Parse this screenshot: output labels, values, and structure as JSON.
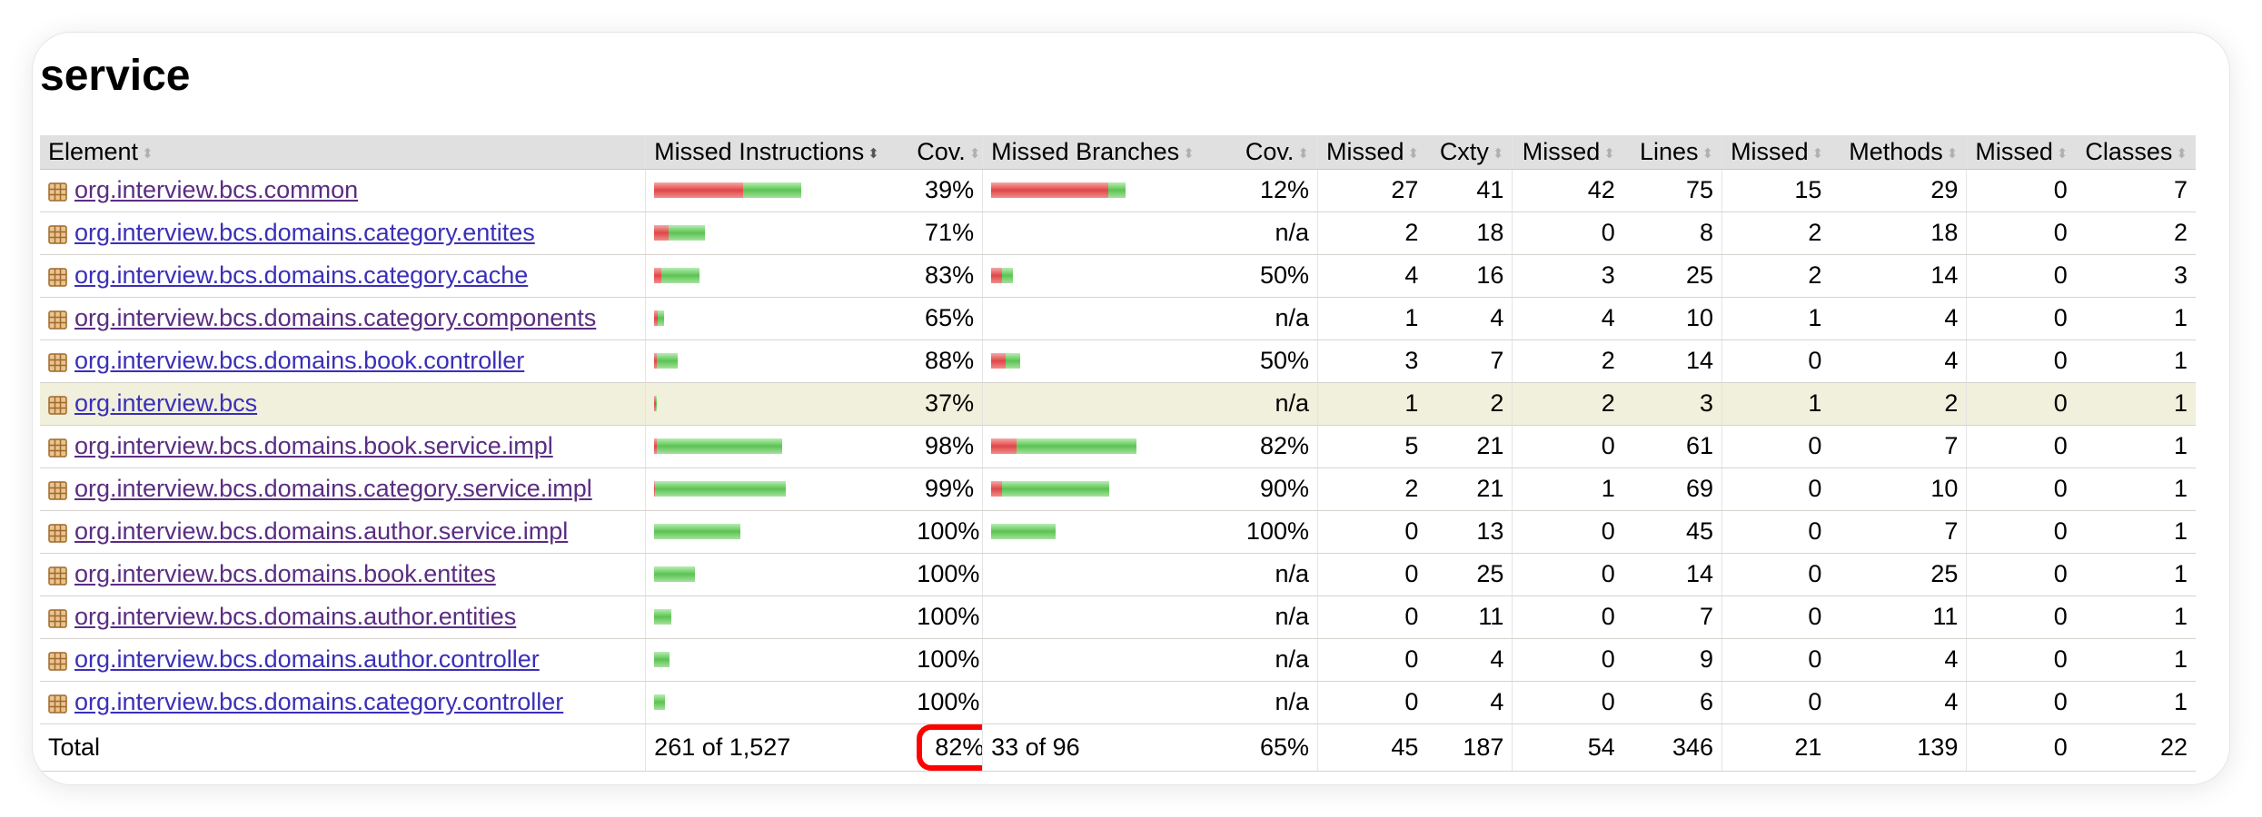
{
  "page": {
    "title": "service"
  },
  "headers": {
    "element": "Element",
    "missed_instructions": "Missed Instructions",
    "cov_instr": "Cov.",
    "missed_branches": "Missed Branches",
    "cov_branch": "Cov.",
    "missed_cxty": "Missed",
    "cxty": "Cxty",
    "missed_lines": "Missed",
    "lines": "Lines",
    "missed_methods": "Missed",
    "methods": "Methods",
    "missed_classes": "Missed",
    "classes": "Classes"
  },
  "sort_icons": {
    "default": "sort-icon",
    "active": "sort-desc-icon"
  },
  "rows": [
    {
      "name": "org.interview.bcs.common",
      "visited": true,
      "instr_bar": {
        "missed": 0.37,
        "covered": 0.24
      },
      "instr_cov": "39%",
      "branch_bar": {
        "missed": 0.55,
        "covered": 0.08
      },
      "branch_cov": "12%",
      "missed_cxty": "27",
      "cxty": "41",
      "missed_lines": "42",
      "lines": "75",
      "missed_methods": "15",
      "methods": "29",
      "missed_classes": "0",
      "classes": "7"
    },
    {
      "name": "org.interview.bcs.domains.category.entites",
      "visited": false,
      "instr_bar": {
        "missed": 0.06,
        "covered": 0.15
      },
      "instr_cov": "71%",
      "branch_bar": null,
      "branch_cov": "n/a",
      "missed_cxty": "2",
      "cxty": "18",
      "missed_lines": "0",
      "lines": "8",
      "missed_methods": "2",
      "methods": "18",
      "missed_classes": "0",
      "classes": "2"
    },
    {
      "name": "org.interview.bcs.domains.category.cache",
      "visited": false,
      "instr_bar": {
        "missed": 0.03,
        "covered": 0.16
      },
      "instr_cov": "83%",
      "branch_bar": {
        "missed": 0.05,
        "covered": 0.05
      },
      "branch_cov": "50%",
      "missed_cxty": "4",
      "cxty": "16",
      "missed_lines": "3",
      "lines": "25",
      "missed_methods": "2",
      "methods": "14",
      "missed_classes": "0",
      "classes": "3"
    },
    {
      "name": "org.interview.bcs.domains.category.components",
      "visited": true,
      "instr_bar": {
        "missed": 0.015,
        "covered": 0.027
      },
      "instr_cov": "65%",
      "branch_bar": null,
      "branch_cov": "n/a",
      "missed_cxty": "1",
      "cxty": "4",
      "missed_lines": "4",
      "lines": "10",
      "missed_methods": "1",
      "methods": "4",
      "missed_classes": "0",
      "classes": "1"
    },
    {
      "name": "org.interview.bcs.domains.book.controller",
      "visited": false,
      "instr_bar": {
        "missed": 0.012,
        "covered": 0.085
      },
      "instr_cov": "88%",
      "branch_bar": {
        "missed": 0.07,
        "covered": 0.07
      },
      "branch_cov": "50%",
      "missed_cxty": "3",
      "cxty": "7",
      "missed_lines": "2",
      "lines": "14",
      "missed_methods": "0",
      "methods": "4",
      "missed_classes": "0",
      "classes": "1"
    },
    {
      "name": "org.interview.bcs",
      "visited": false,
      "highlight": true,
      "instr_bar": {
        "missed": 0.006,
        "covered": 0.004
      },
      "instr_cov": "37%",
      "branch_bar": null,
      "branch_cov": "n/a",
      "missed_cxty": "1",
      "cxty": "2",
      "missed_lines": "2",
      "lines": "3",
      "missed_methods": "1",
      "methods": "2",
      "missed_classes": "0",
      "classes": "1"
    },
    {
      "name": "org.interview.bcs.domains.book.service.impl",
      "visited": true,
      "instr_bar": {
        "missed": 0.01,
        "covered": 0.52
      },
      "instr_cov": "98%",
      "branch_bar": {
        "missed": 0.12,
        "covered": 0.56
      },
      "branch_cov": "82%",
      "missed_cxty": "5",
      "cxty": "21",
      "missed_lines": "0",
      "lines": "61",
      "missed_methods": "0",
      "methods": "7",
      "missed_classes": "0",
      "classes": "1"
    },
    {
      "name": "org.interview.bcs.domains.category.service.impl",
      "visited": true,
      "instr_bar": {
        "missed": 0.005,
        "covered": 0.545
      },
      "instr_cov": "99%",
      "branch_bar": {
        "missed": 0.05,
        "covered": 0.5
      },
      "branch_cov": "90%",
      "missed_cxty": "2",
      "cxty": "21",
      "missed_lines": "1",
      "lines": "69",
      "missed_methods": "0",
      "methods": "10",
      "missed_classes": "0",
      "classes": "1"
    },
    {
      "name": "org.interview.bcs.domains.author.service.impl",
      "visited": true,
      "instr_bar": {
        "missed": 0,
        "covered": 0.36
      },
      "instr_cov": "100%",
      "branch_bar": {
        "missed": 0,
        "covered": 0.3
      },
      "branch_cov": "100%",
      "missed_cxty": "0",
      "cxty": "13",
      "missed_lines": "0",
      "lines": "45",
      "missed_methods": "0",
      "methods": "7",
      "missed_classes": "0",
      "classes": "1"
    },
    {
      "name": "org.interview.bcs.domains.book.entites",
      "visited": true,
      "instr_bar": {
        "missed": 0,
        "covered": 0.17
      },
      "instr_cov": "100%",
      "branch_bar": null,
      "branch_cov": "n/a",
      "missed_cxty": "0",
      "cxty": "25",
      "missed_lines": "0",
      "lines": "14",
      "missed_methods": "0",
      "methods": "25",
      "missed_classes": "0",
      "classes": "1"
    },
    {
      "name": "org.interview.bcs.domains.author.entities",
      "visited": true,
      "instr_bar": {
        "missed": 0,
        "covered": 0.07
      },
      "instr_cov": "100%",
      "branch_bar": null,
      "branch_cov": "n/a",
      "missed_cxty": "0",
      "cxty": "11",
      "missed_lines": "0",
      "lines": "7",
      "missed_methods": "0",
      "methods": "11",
      "missed_classes": "0",
      "classes": "1"
    },
    {
      "name": "org.interview.bcs.domains.author.controller",
      "visited": false,
      "instr_bar": {
        "missed": 0,
        "covered": 0.065
      },
      "instr_cov": "100%",
      "branch_bar": null,
      "branch_cov": "n/a",
      "missed_cxty": "0",
      "cxty": "4",
      "missed_lines": "0",
      "lines": "9",
      "missed_methods": "0",
      "methods": "4",
      "missed_classes": "0",
      "classes": "1"
    },
    {
      "name": "org.interview.bcs.domains.category.controller",
      "visited": false,
      "instr_bar": {
        "missed": 0,
        "covered": 0.045
      },
      "instr_cov": "100%",
      "branch_bar": null,
      "branch_cov": "n/a",
      "missed_cxty": "0",
      "cxty": "4",
      "missed_lines": "0",
      "lines": "6",
      "missed_methods": "0",
      "methods": "4",
      "missed_classes": "0",
      "classes": "1"
    }
  ],
  "total": {
    "label": "Total",
    "missed_instructions": "261 of 1,527",
    "instr_cov": "82%",
    "missed_branches": "33 of 96",
    "branch_cov": "65%",
    "missed_cxty": "45",
    "cxty": "187",
    "missed_lines": "54",
    "lines": "346",
    "missed_methods": "21",
    "methods": "139",
    "missed_classes": "0",
    "classes": "22"
  },
  "colors": {
    "missed": "#e04646",
    "covered": "#5bc352",
    "highlight_row": "#f0f0dc",
    "annotation_circle": "#ff0000",
    "link": "#3b2fb8",
    "link_visited": "#5a2d82"
  }
}
